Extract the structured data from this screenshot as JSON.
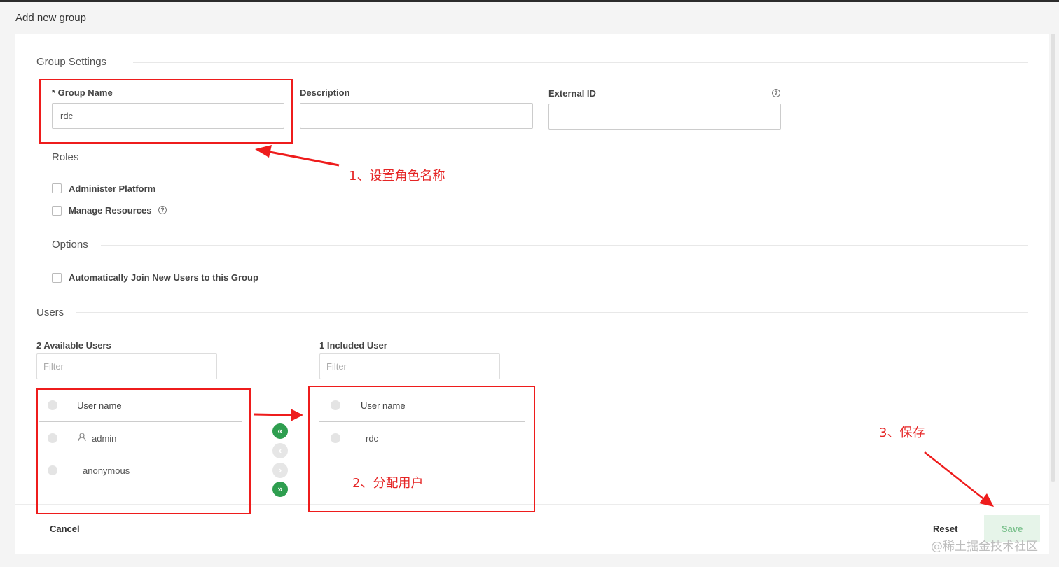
{
  "page": {
    "title": "Add new group"
  },
  "group_settings": {
    "section_title": "Group Settings",
    "group_name": {
      "label": "* Group Name",
      "value": "rdc"
    },
    "description": {
      "label": "Description",
      "value": ""
    },
    "external_id": {
      "label": "External ID",
      "value": ""
    }
  },
  "roles": {
    "section_title": "Roles",
    "items": [
      {
        "label": "Administer Platform",
        "checked": false
      },
      {
        "label": "Manage Resources",
        "checked": false
      }
    ]
  },
  "options": {
    "section_title": "Options",
    "items": [
      {
        "label": "Automatically Join New Users to this Group",
        "checked": false
      }
    ]
  },
  "users": {
    "section_title": "Users",
    "available": {
      "title": "2 Available Users",
      "filter_placeholder": "Filter",
      "column": "User name",
      "rows": [
        "admin",
        "anonymous"
      ]
    },
    "included": {
      "title": "1 Included User",
      "filter_placeholder": "Filter",
      "column": "User name",
      "rows": [
        "rdc"
      ]
    },
    "move_buttons": [
      "«",
      "‹",
      "›",
      "»"
    ]
  },
  "annotations": {
    "step1": "1、设置角色名称",
    "step2": "2、分配用户",
    "step3": "3、保存"
  },
  "footer": {
    "cancel": "Cancel",
    "reset": "Reset",
    "save": "Save"
  },
  "watermark": "@稀土掘金技术社区",
  "colors": {
    "accent_green": "#2e9e4f",
    "annotation_red": "#e52525"
  },
  "icons": {
    "help": "question-circle-icon",
    "user": "user-icon"
  }
}
